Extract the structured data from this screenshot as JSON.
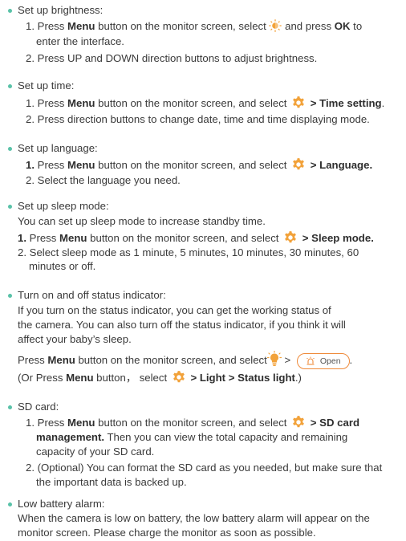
{
  "brightness": {
    "title": "Set up brightness:",
    "l1_a": "1. Press ",
    "l1_menu": "Menu",
    "l1_b": " button on the monitor screen, select ",
    "l1_c": " and press ",
    "l1_ok": "OK",
    "l1_d": " to",
    "l1_cont": "enter the interface.",
    "l2": "2. Press UP and DOWN direction buttons to adjust brightness."
  },
  "time": {
    "title": "Set up time:",
    "l1_a": "1. Press ",
    "l1_menu": "Menu",
    "l1_b": " button on the monitor screen, and select ",
    "l1_c": " > Time setting",
    "l1_d": ".",
    "l2": "2. Press direction buttons to change date, time and time displaying mode."
  },
  "language": {
    "title": "Set up language:",
    "l1_num": "1.",
    "l1_a": " Press ",
    "l1_menu": "Menu",
    "l1_b": " button on the monitor screen, and select ",
    "l1_c": " > Language.",
    "l2": "2. Select the language you need."
  },
  "sleep": {
    "title": "Set up sleep mode:",
    "intro": "You can set up sleep mode to increase standby time.",
    "l1_num": "1.",
    "l1_a": " Press ",
    "l1_menu": "Menu",
    "l1_b": " button on the monitor screen, and select ",
    "l1_c": " > Sleep mode.",
    "l2": "2. Select sleep mode as 1 minute, 5 minutes, 10 minutes, 30 minutes, 60",
    "l2_cont": "minutes or off."
  },
  "status": {
    "title": "Turn on and off status indicator:",
    "p1": "If you turn on the status indicator, you can get the working status of",
    "p2": "the camera. You can also turn off the status indicator, if you think it will",
    "p3": "affect your baby’s sleep.",
    "l1_a": "Press ",
    "l1_menu": "Menu",
    "l1_b": " button on the monitor screen, and select",
    "l1_gt": " > ",
    "open_label": "Open",
    "l1_end": ".",
    "l2_a": "(Or Press ",
    "l2_menu": "Menu",
    "l2_b": " button， select ",
    "l2_c": " > Light > Status light",
    "l2_d": ".)"
  },
  "sd": {
    "title": "SD card:",
    "l1_a": "1. Press ",
    "l1_menu": "Menu",
    "l1_b": " button on the monitor screen, and select ",
    "l1_c": " > SD card",
    "l1_cont_b": "management.",
    "l1_cont": " Then you can view the total capacity and remaining",
    "l1_cont2": "capacity of your SD card.",
    "l2": "2. (Optional) You can format the SD card as you needed, but make sure that",
    "l2_cont": "the important data is backed up."
  },
  "battery": {
    "title": "Low battery alarm:",
    "p1": "When the camera is low on battery, the low battery alarm will appear on the",
    "p2": "monitor screen. Please charge the monitor as soon as possible."
  },
  "colors": {
    "bullet": "#59c2a8",
    "gear": "#f0a030",
    "text": "#3a3a3a"
  }
}
